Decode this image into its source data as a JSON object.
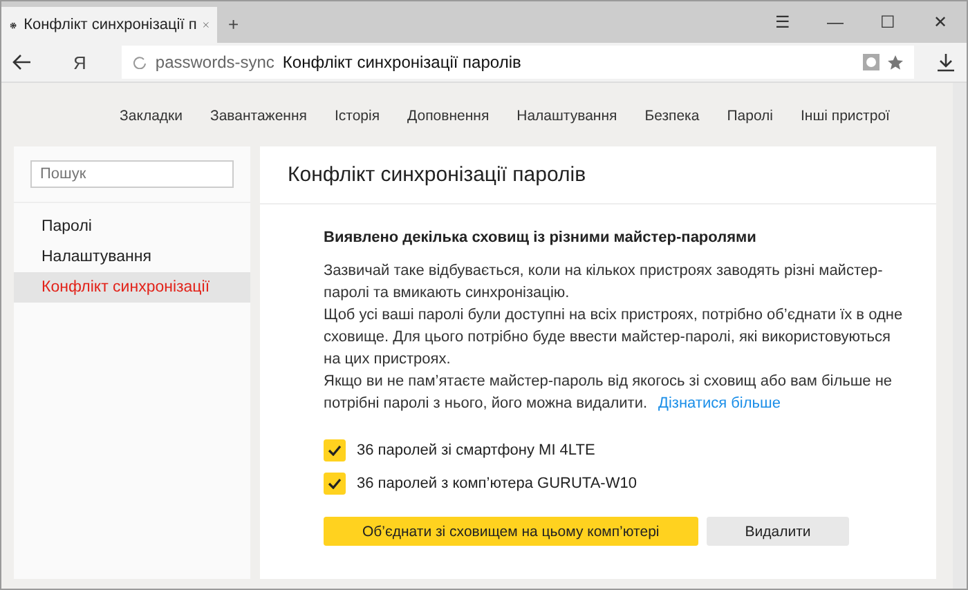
{
  "tab": {
    "title": "Конфлікт синхронізації п",
    "new_tab": "+"
  },
  "window_controls": [
    "☰",
    "—",
    "☐",
    "✕"
  ],
  "address": {
    "logo": "Я",
    "host": "passwords-sync",
    "title": "Конфлікт синхронізації паролів"
  },
  "nav": [
    {
      "label": "Закладки"
    },
    {
      "label": "Завантаження"
    },
    {
      "label": "Історія"
    },
    {
      "label": "Доповнення"
    },
    {
      "label": "Налаштування"
    },
    {
      "label": "Безпека"
    },
    {
      "label": "Паролі"
    },
    {
      "label": "Інші пристрої"
    }
  ],
  "sidebar": {
    "search": {
      "placeholder": "Пошук"
    },
    "items": [
      {
        "label": "Паролі",
        "selected": false
      },
      {
        "label": "Налаштування",
        "selected": false
      },
      {
        "label": "Конфлікт синхронізації",
        "selected": true
      }
    ]
  },
  "content": {
    "title": "Конфлікт синхронізації паролів",
    "heading": "Виявлено декілька сховищ із різними майстер-паролями",
    "paragraphs": [
      "Зазвичай таке відбувається, коли на кількох пристроях заводять різні майстер-паролі та вмикають синхронізацію.",
      "Щоб усі ваші паролі були доступні на всіх пристроях, потрібно об’єднати їх в одне сховище. Для цього потрібно буде ввести майстер-паролі, які використовуються на цих пристроях.",
      "Якщо ви не пам’ятаєте майстер-пароль від якогось зі сховищ або вам більше не потрібні паролі з нього, його можна видалити."
    ],
    "link": "Дізнатися більше",
    "options": [
      {
        "label": "36 паролей зі смартфону MI 4LTE",
        "checked": true
      },
      {
        "label": "36 паролей з комп’ютера GURUTA-W10",
        "checked": true
      }
    ],
    "buttons": [
      {
        "label": "Об’єднати зі сховищем на цьому комп’ютері",
        "kind": "primary"
      },
      {
        "label": "Видалити",
        "kind": "secondary"
      }
    ]
  }
}
